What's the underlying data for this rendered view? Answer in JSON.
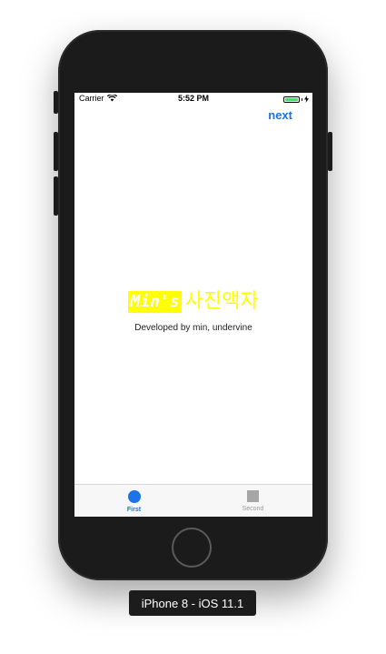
{
  "status_bar": {
    "carrier": "Carrier",
    "time": "5:52 PM",
    "battery_color": "#4cd964"
  },
  "nav": {
    "next_label": "next",
    "accent_color": "#1a73e8"
  },
  "main": {
    "brand": "Min's",
    "title": "사진액자",
    "subtitle": "Developed by min, undervine",
    "title_color": "#ffff00"
  },
  "tab_bar": {
    "tabs": [
      {
        "label": "First",
        "icon": "circle-icon",
        "selected": true
      },
      {
        "label": "Second",
        "icon": "square-icon",
        "selected": false
      }
    ]
  },
  "simulator": {
    "device_label": "iPhone 8 - iOS 11.1"
  }
}
